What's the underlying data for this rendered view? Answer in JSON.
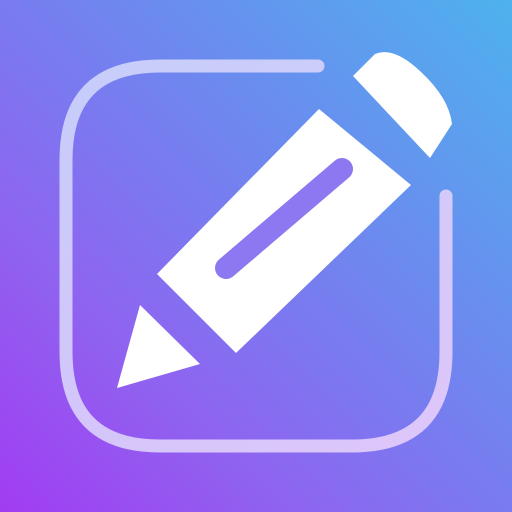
{
  "icon": {
    "name": "edit-note-app-icon",
    "glyph": "pencil-icon",
    "frame": "rounded-square-outline",
    "colors": {
      "gradient_top_right": "#4eb2ee",
      "gradient_middle": "#7a78ef",
      "gradient_bottom_left": "#a13cf2",
      "frame_stroke": "#d8d2fb",
      "pencil": "#ffffff"
    }
  }
}
